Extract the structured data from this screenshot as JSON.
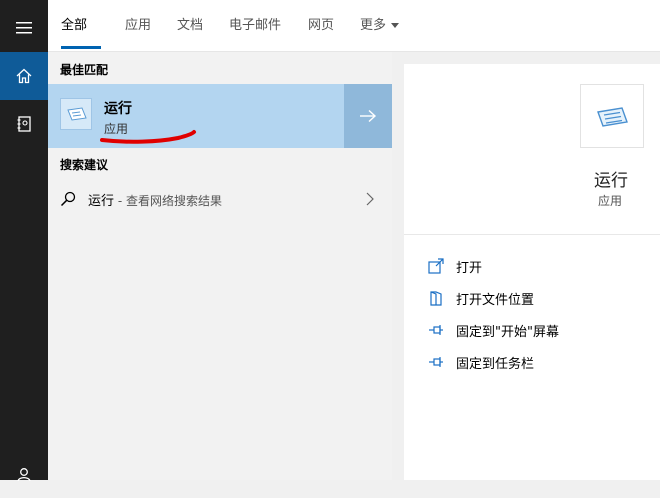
{
  "tabs": [
    {
      "label": "全部"
    },
    {
      "label": "应用"
    },
    {
      "label": "文档"
    },
    {
      "label": "电子邮件"
    },
    {
      "label": "网页"
    },
    {
      "label": "更多"
    }
  ],
  "rail": {
    "icons": [
      "hamburger-menu-icon",
      "home-icon",
      "notebook-icon",
      "user-icon"
    ]
  },
  "results": {
    "best_match_label": "最佳匹配",
    "best": {
      "title": "运行",
      "subtitle": "应用"
    },
    "suggestions_label": "搜索建议",
    "suggestion": {
      "term": "运行",
      "extra": " - 查看网络搜索结果"
    }
  },
  "detail": {
    "title": "运行",
    "subtitle": "应用",
    "actions": [
      {
        "label": "打开",
        "icon": "open-icon"
      },
      {
        "label": "打开文件位置",
        "icon": "file-location-icon"
      },
      {
        "label": "固定到\"开始\"屏幕",
        "icon": "pin-icon"
      },
      {
        "label": "固定到任务栏",
        "icon": "pin-icon"
      }
    ]
  },
  "colors": {
    "accent": "#0063b1",
    "rail": "#1f1f1f",
    "selected": "#b3d5f0",
    "annotation": "#e00000"
  }
}
